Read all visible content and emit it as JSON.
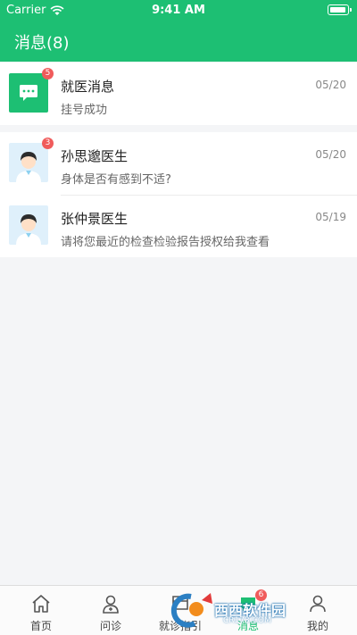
{
  "status_bar": {
    "carrier": "Carrier",
    "time": "9:41 AM"
  },
  "header": {
    "title": "消息(8)"
  },
  "system_message": {
    "name": "就医消息",
    "preview": "挂号成功",
    "date": "05/20",
    "badge": "5",
    "icon": "chat-bubble-icon"
  },
  "doctor_messages": [
    {
      "name": "孙思邈医生",
      "preview": "身体是否有感到不适?",
      "date": "05/20",
      "badge": "3",
      "icon": "doctor-avatar"
    },
    {
      "name": "张仲景医生",
      "preview": "请将您最近的检查检验报告授权给我查看",
      "date": "05/19",
      "badge": "",
      "icon": "doctor-avatar"
    }
  ],
  "tabbar": {
    "tabs": [
      {
        "label": "首页",
        "icon": "home-icon"
      },
      {
        "label": "问诊",
        "icon": "doctor-icon"
      },
      {
        "label": "就诊指引",
        "icon": "guide-icon"
      },
      {
        "label": "消息",
        "icon": "message-icon",
        "badge": "6",
        "active": true
      },
      {
        "label": "我的",
        "icon": "profile-icon"
      }
    ]
  },
  "watermark": {
    "text": "西西软件园",
    "sub": "CR173.COM"
  },
  "colors": {
    "brand": "#1dbf73",
    "badge": "#f05b5b"
  }
}
